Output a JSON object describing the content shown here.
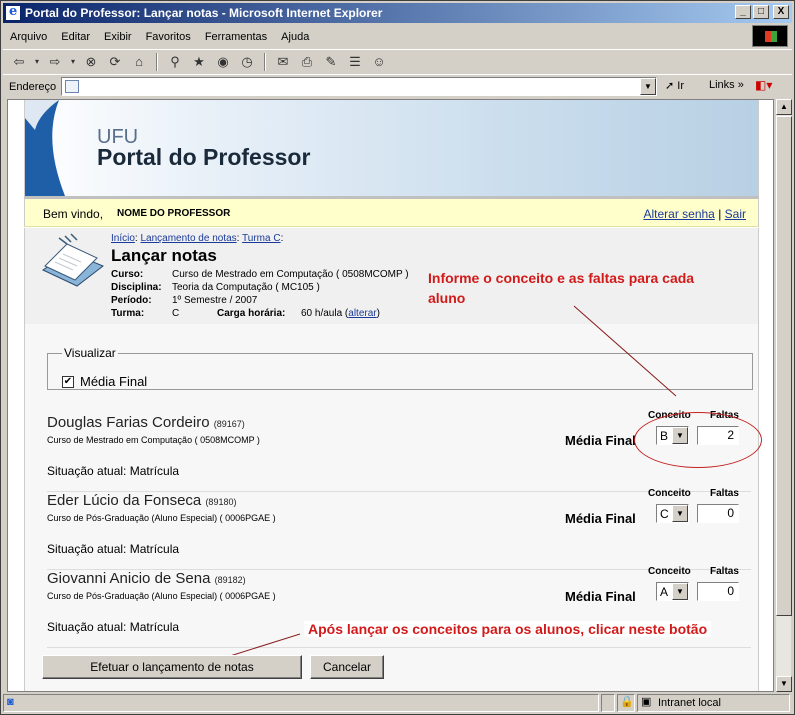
{
  "window": {
    "title": "Portal do Professor: Lançar notas - Microsoft Internet Explorer",
    "buttons": [
      "_",
      "□",
      "X"
    ]
  },
  "menu": [
    "Arquivo",
    "Editar",
    "Exibir",
    "Favoritos",
    "Ferramentas",
    "Ajuda"
  ],
  "address_bar": {
    "label": "Endereço",
    "value": "",
    "go_label": "Ir",
    "links_label": "Links"
  },
  "header": {
    "org": "UFU",
    "portal": "Portal do Professor"
  },
  "welcome": {
    "greeting": "Bem vindo,",
    "name": "NOME DO PROFESSOR",
    "change_password": "Alterar senha",
    "separator": "|",
    "logout": "Sair"
  },
  "breadcrumb": {
    "home": "Início",
    "launch": "Lançamento de notas",
    "class": "Turma C",
    "sep": ":"
  },
  "page_title": "Lançar notas",
  "course_info": {
    "curso_label": "Curso:",
    "curso": "Curso de Mestrado em Computação ( 0508MCOMP )",
    "disciplina_label": "Disciplina:",
    "disciplina": "Teoria da Computação ( MC105 )",
    "periodo_label": "Período:",
    "periodo": "1º Semestre / 2007",
    "turma_label": "Turma:",
    "turma": "C",
    "carga_label": "Carga horária:",
    "carga": "60 h/aula (",
    "alterar": "alterar",
    "carga_close": ")"
  },
  "annotations": {
    "top": "Informe o conceito e as faltas para cada aluno",
    "bottom": "Após lançar os conceitos para os alunos, clicar neste botão"
  },
  "visualizar": {
    "legend": "Visualizar",
    "checkbox_label": "Média Final",
    "checked": true
  },
  "col_headers": {
    "conceito": "Conceito",
    "faltas": "Faltas",
    "media_final": "Média Final"
  },
  "students": [
    {
      "name": "Douglas Farias Cordeiro",
      "id": "(89167)",
      "course": "Curso de Mestrado em Computação ( 0508MCOMP )",
      "situation": "Situação atual: Matrícula",
      "conceito": "B",
      "faltas": "2"
    },
    {
      "name": "Eder Lúcio da Fonseca",
      "id": "(89180)",
      "course": "Curso de Pós-Graduação (Aluno Especial) ( 0006PGAE )",
      "situation": "Situação atual: Matrícula",
      "conceito": "C",
      "faltas": "0"
    },
    {
      "name": "Giovanni Anicio de Sena",
      "id": "(89182)",
      "course": "Curso de Pós-Graduação (Aluno Especial) ( 0006PGAE )",
      "situation": "Situação atual: Matrícula",
      "conceito": "A",
      "faltas": "0"
    }
  ],
  "buttons": {
    "submit": "Efetuar o lançamento de notas",
    "cancel": "Cancelar"
  },
  "status": {
    "zone": "Intranet local"
  },
  "colors": {
    "annotation": "#d21a1a",
    "title_gradient_start": "#0a246a",
    "welcome_bg": "#ffffcc"
  }
}
